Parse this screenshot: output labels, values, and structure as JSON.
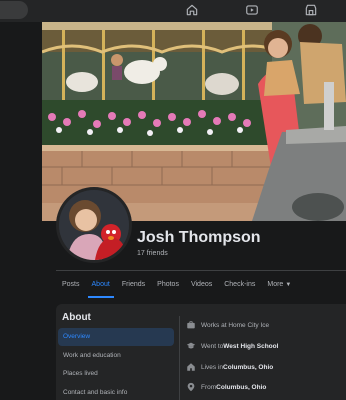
{
  "profile": {
    "name": "Josh Thompson",
    "friends": "17 friends"
  },
  "tabs": [
    {
      "label": "Posts"
    },
    {
      "label": "About"
    },
    {
      "label": "Friends"
    },
    {
      "label": "Photos"
    },
    {
      "label": "Videos"
    },
    {
      "label": "Check-ins"
    },
    {
      "label": "More"
    }
  ],
  "about": {
    "title": "About",
    "nav": [
      {
        "label": "Overview"
      },
      {
        "label": "Work and education"
      },
      {
        "label": "Places lived"
      },
      {
        "label": "Contact and basic info"
      }
    ],
    "details": [
      {
        "icon": "briefcase-icon",
        "prefix": "Works at Home City Ice",
        "bold": ""
      },
      {
        "icon": "graduation-cap-icon",
        "prefix": "Went to ",
        "bold": "West High School"
      },
      {
        "icon": "home-icon",
        "prefix": "Lives in ",
        "bold": "Columbus, Ohio"
      },
      {
        "icon": "location-pin-icon",
        "prefix": "From ",
        "bold": "Columbus, Ohio"
      }
    ]
  },
  "top_nav": {
    "icons": [
      "home-icon",
      "watch-icon",
      "marketplace-icon"
    ]
  },
  "colors": {
    "background": "#18191a",
    "surface": "#242526",
    "accent": "#2d88ff",
    "text_primary": "#e4e6eb",
    "text_secondary": "#b0b3b8"
  }
}
